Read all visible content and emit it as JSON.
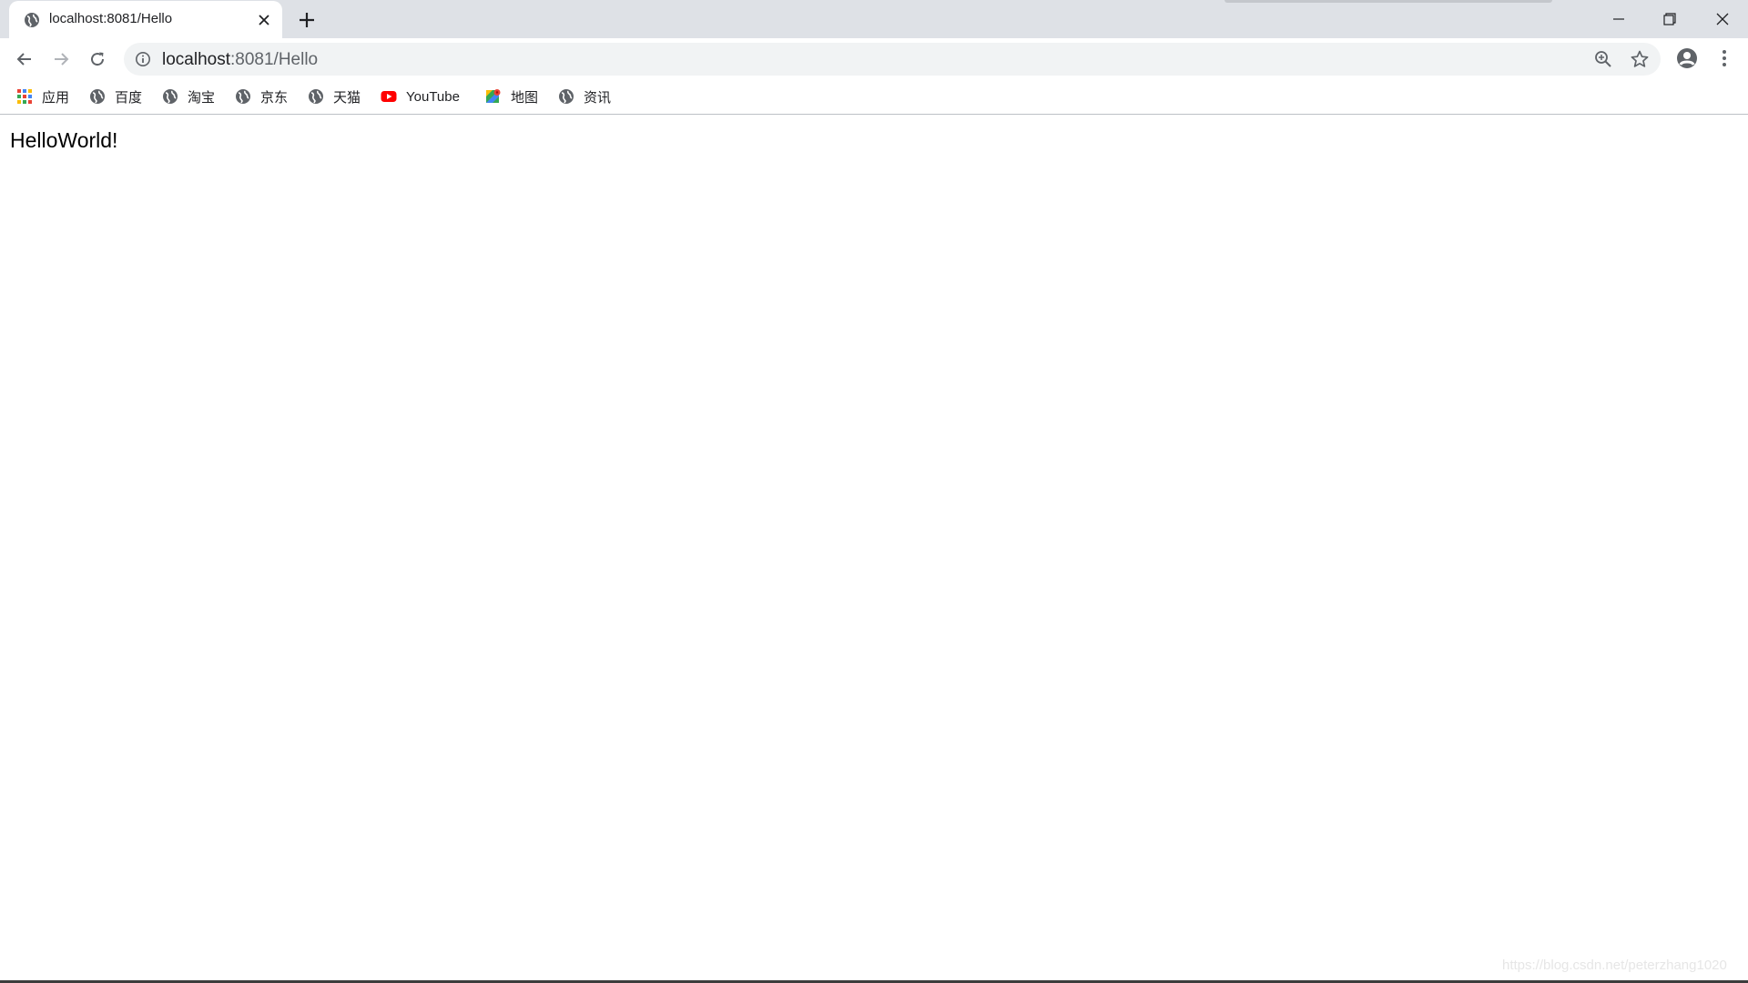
{
  "browser": {
    "tab": {
      "title": "localhost:8081/Hello",
      "favicon": "globe-icon"
    },
    "window_controls": [
      "minimize-icon",
      "restore-icon",
      "close-icon"
    ]
  },
  "toolbar": {
    "url_host": "localhost",
    "url_path": ":8081/Hello",
    "icons": [
      "back-arrow-icon",
      "forward-arrow-icon",
      "reload-icon",
      "info-icon",
      "zoom-icon",
      "star-icon",
      "profile-icon",
      "menu-icon"
    ]
  },
  "bookmarks": {
    "items": [
      {
        "label": "应用",
        "icon": "apps-grid-icon"
      },
      {
        "label": "百度",
        "icon": "globe-icon"
      },
      {
        "label": "淘宝",
        "icon": "globe-icon"
      },
      {
        "label": "京东",
        "icon": "globe-icon"
      },
      {
        "label": "天猫",
        "icon": "globe-icon"
      },
      {
        "label": "YouTube",
        "icon": "youtube-icon"
      },
      {
        "label": "地图",
        "icon": "maps-icon"
      },
      {
        "label": "资讯",
        "icon": "globe-icon"
      }
    ]
  },
  "page": {
    "content": "HelloWorld!",
    "watermark": "https://blog.csdn.net/peterzhang1020"
  },
  "colors": {
    "tabstrip": "#dee1e6",
    "omnibox": "#f1f3f4",
    "youtube": "#ff0000",
    "icon": "#5f6368"
  }
}
